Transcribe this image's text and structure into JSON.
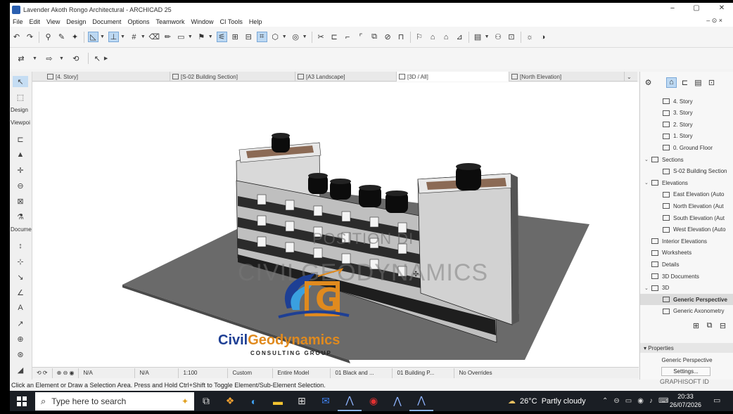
{
  "window": {
    "title": "Lavender Akoth Rongo Architectural - ARCHICAD 25",
    "controls": {
      "minimize": "−",
      "maximize": "▢",
      "close": "✕"
    }
  },
  "menu": {
    "items": [
      "File",
      "Edit",
      "View",
      "Design",
      "Document",
      "Options",
      "Teamwork",
      "Window",
      "CI Tools",
      "Help"
    ],
    "right": "– ⊙ ×"
  },
  "toolbox": {
    "labels": {
      "design": "Design",
      "viewpoint": "Viewpoi",
      "document": "Docume"
    }
  },
  "tabs": [
    {
      "label": "[4. Story]",
      "active": false
    },
    {
      "label": "[S-02 Building Section]",
      "active": false
    },
    {
      "label": "[A3 Landscape]",
      "active": false
    },
    {
      "label": "[3D / All]",
      "active": true
    },
    {
      "label": "[North Elevation]",
      "active": false
    }
  ],
  "view_bar": {
    "scale_value": "N/A",
    "zoom_value": "N/A",
    "scale": "1:100",
    "pen_set": "Custom",
    "model_view": "Entire Model",
    "layer_combo": "01 Black and ...",
    "graphic_override": "01 Building P...",
    "overrides": "No Overrides"
  },
  "status_text": "Click an Element or Draw a Selection Area. Press and Hold Ctrl+Shift to Toggle Element/Sub-Element Selection.",
  "navigator": {
    "rows": [
      {
        "label": "4. Story",
        "indent": 2,
        "twisty": ""
      },
      {
        "label": "3. Story",
        "indent": 2,
        "twisty": ""
      },
      {
        "label": "2. Story",
        "indent": 2,
        "twisty": ""
      },
      {
        "label": "1. Story",
        "indent": 2,
        "twisty": ""
      },
      {
        "label": "0. Ground Floor",
        "indent": 2,
        "twisty": ""
      },
      {
        "label": "Sections",
        "indent": 1,
        "twisty": "v"
      },
      {
        "label": "S-02 Building Section",
        "indent": 2,
        "twisty": ""
      },
      {
        "label": "Elevations",
        "indent": 1,
        "twisty": "v"
      },
      {
        "label": "East Elevation (Auto",
        "indent": 2,
        "twisty": ""
      },
      {
        "label": "North Elevation (Aut",
        "indent": 2,
        "twisty": ""
      },
      {
        "label": "South Elevation (Aut",
        "indent": 2,
        "twisty": ""
      },
      {
        "label": "West Elevation (Auto",
        "indent": 2,
        "twisty": ""
      },
      {
        "label": "Interior Elevations",
        "indent": 1,
        "twisty": ""
      },
      {
        "label": "Worksheets",
        "indent": 1,
        "twisty": ""
      },
      {
        "label": "Details",
        "indent": 1,
        "twisty": ""
      },
      {
        "label": "3D Documents",
        "indent": 1,
        "twisty": ""
      },
      {
        "label": "3D",
        "indent": 1,
        "twisty": "v"
      },
      {
        "label": "Generic Perspective",
        "indent": 2,
        "twisty": "",
        "selected": true
      },
      {
        "label": "Generic Axonometry",
        "indent": 2,
        "twisty": ""
      }
    ],
    "properties_header": "Properties",
    "properties_value": "Generic Perspective",
    "settings_button": "Settings...",
    "brand": "GRAPHISOFT ID"
  },
  "watermark": {
    "line1": "POSITION DI",
    "line2": "CIVILGEODYNAMICS",
    "logo_letter": "G",
    "logo_name_1": "Civil",
    "logo_name_2": "Geodynamics",
    "logo_tagline": "CONSULTING GROUP"
  },
  "taskbar": {
    "search_placeholder": "Type here to search",
    "weather_temp": "26°C",
    "weather_text": "Partly cloudy",
    "time": "20:33",
    "date": "26/07/2026"
  },
  "colors": {
    "accent": "#2a6fd6",
    "active_tool": "#c5ddf3",
    "logo_blue": "#1e3f94",
    "logo_orange": "#e08a1e"
  }
}
